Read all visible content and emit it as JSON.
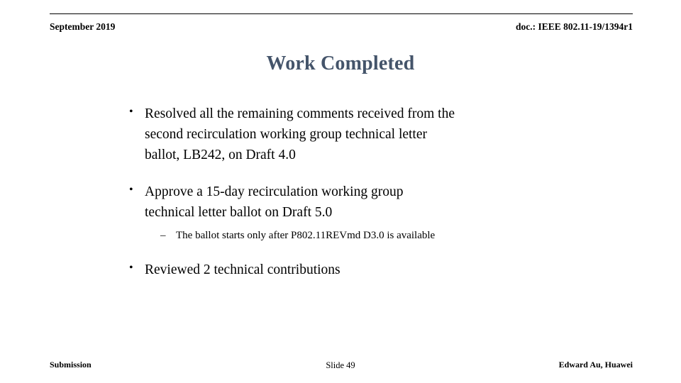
{
  "header": {
    "left": "September 2019",
    "right": "doc.: IEEE 802.11-19/1394r1"
  },
  "title": "Work Completed",
  "content": {
    "bullet_marker": "•",
    "dash_marker": "–",
    "bullets": [
      {
        "line1": "Resolved all the remaining comments received from the",
        "line2_words": [
          "second",
          "recirculation",
          "working",
          "group",
          "technical",
          "letter"
        ],
        "line3": "ballot, LB242, on Draft 4.0"
      },
      {
        "line1_words": [
          "Approve",
          "a",
          "15-day",
          "recirculation",
          "working",
          "group"
        ],
        "line2": "technical letter ballot on Draft 5.0"
      },
      {
        "line1": "Reviewed 2 technical contributions"
      }
    ],
    "subbullet": "The ballot starts only after P802.11REVmd D3.0 is available"
  },
  "footer": {
    "left": "Submission",
    "center": "Slide 49",
    "right": "Edward Au, Huawei"
  },
  "colors": {
    "title": "#44546a",
    "text": "#000000",
    "background": "#ffffff"
  }
}
